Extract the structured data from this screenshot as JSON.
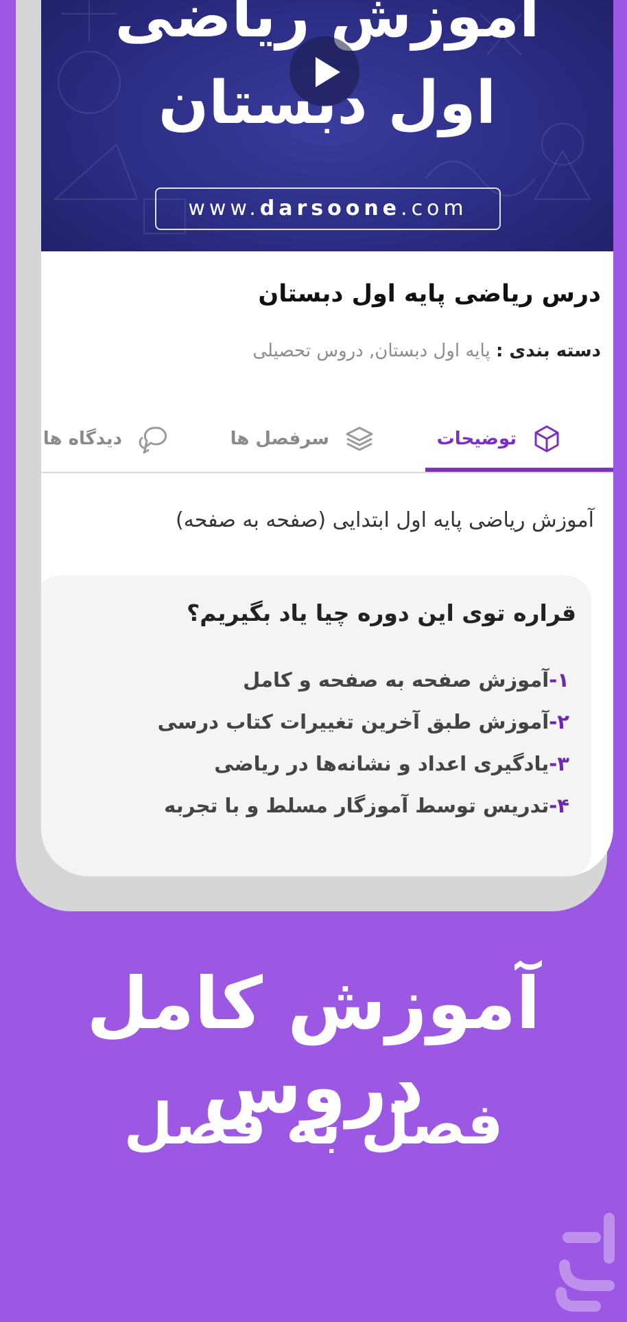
{
  "video": {
    "title_line1": "آموزش ریاضی",
    "title_line2": "اول دبستان",
    "url_prefix": "www.",
    "url_brand": "darsoone",
    "url_suffix": ".com",
    "play_icon": "play-icon"
  },
  "course": {
    "title": "درس ریاضی پایه اول دبستان",
    "category_label": "دسته بندی :",
    "category_value": "پایه اول دبستان, دروس تحصیلی"
  },
  "tabs": [
    {
      "label": "توضیحات",
      "icon": "cube-icon",
      "active": true
    },
    {
      "label": "سرفصل ها",
      "icon": "layers-icon",
      "active": false
    },
    {
      "label": "دیدگاه ها",
      "icon": "chat-bubbles-icon",
      "active": false
    }
  ],
  "description": {
    "intro": "آموزش ریاضی پایه اول ابتدایی (صفحه به صفحه)",
    "card_title": "قراره توی این دوره چیا یاد بگیریم؟",
    "items": [
      {
        "num": "۱-",
        "text": "آموزش صفحه به صفحه و کامل"
      },
      {
        "num": "۲-",
        "text": "آموزش طبق آخرین تغییرات کتاب درسی"
      },
      {
        "num": "۳-",
        "text": "یادگیری اعداد و نشانه‌ها در ریاضی"
      },
      {
        "num": "۴-",
        "text": "تدریس توسط آموزگار مسلط و با تجربه"
      }
    ]
  },
  "promo": {
    "line1": "آموزش کامل دروس",
    "line2": "فصل به فصل"
  },
  "colors": {
    "background": "#9c57e3",
    "accent": "#7a2fbf",
    "video_bg": "#2b2c82"
  }
}
